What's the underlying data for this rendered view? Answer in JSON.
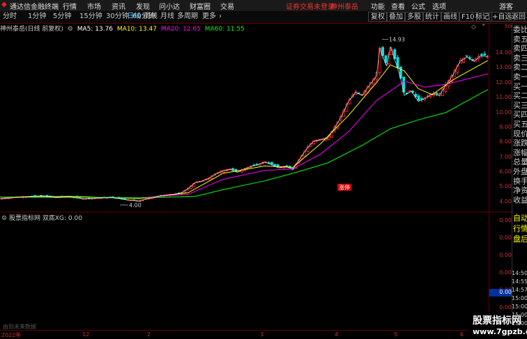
{
  "titlebar": {
    "app_name": "通达信金融终端",
    "menu": [
      "行情",
      "市场",
      "资讯",
      "发现",
      "问小达",
      "财富圈",
      "交易"
    ],
    "notice": "证券交易未登录",
    "stock_name": "神州泰岳",
    "right_menu": [
      "功能",
      "查看",
      "公式",
      "选项",
      "游客"
    ]
  },
  "periods": {
    "items": [
      "分时",
      "1分钟",
      "5分钟",
      "15分钟",
      "30分钟",
      "60分钟",
      "日线",
      "周线",
      "月线",
      "多周期",
      "更多"
    ],
    "active": "日线",
    "more_arrow": "›"
  },
  "toolbar": {
    "buttons": [
      "复权",
      "叠加",
      "多股",
      "统计",
      "画线",
      "F10",
      "标记",
      "+自选",
      "返回"
    ]
  },
  "chart_info": {
    "stock": "神州泰岳(日线 前复权)",
    "ma5_label": "MA5: 13.76",
    "ma10_label": "MA10: 13.47",
    "ma20_label": "MA20: 12.65",
    "ma60_label": "MA60: 11.55",
    "colors": {
      "ma5": "#ffffff",
      "ma10": "#ffff00",
      "ma20": "#ff00ff",
      "ma60": "#00ff00"
    }
  },
  "indicator": {
    "title": "股票指标网",
    "series": "双底XG: 0.00"
  },
  "right_panel": {
    "labels": [
      "委比",
      "卖五",
      "卖四",
      "卖三",
      "卖二",
      "卖一",
      "买一",
      "买二",
      "买三",
      "买四",
      "买五",
      "现价",
      "涨跌",
      "涨幅",
      "总量",
      "外盘",
      "换手",
      "净资",
      "收益"
    ],
    "lower_labels": [
      "自动",
      "行情",
      "盘后"
    ]
  },
  "price_axis": [
    "14.00",
    "13.00",
    "12.00",
    "11.00",
    "10.00",
    "9.00",
    "8.00",
    "7.00",
    "6.00",
    "5.00",
    "4.00"
  ],
  "price_axis_top": "500",
  "indicator_axis": [
    "0.00",
    "0.00",
    "0.00",
    "0.00",
    "0.00",
    "0.00",
    "0.00"
  ],
  "time_axis_labels": [
    "14:50",
    "14:55",
    "14:57",
    "15:00",
    "15:00",
    "15:00",
    "15:00"
  ],
  "indicator_value_box": "0.00",
  "date_axis": [
    "2022年",
    "12",
    "2",
    "3",
    "4",
    "5",
    "6"
  ],
  "annotations": {
    "high": "14.93",
    "low": "4.00",
    "limit_up": "涨停"
  },
  "status_text": "由到未来数据",
  "watermark": {
    "line1": "股票指标网",
    "line2": "www.7gpzb.com"
  },
  "chart_data": {
    "type": "candlestick",
    "title": "神州泰岳(日线 前复权)",
    "ylim": [
      3.7,
      15.6
    ],
    "y_ticks": [
      4,
      5,
      6,
      7,
      8,
      9,
      10,
      11,
      12,
      13,
      14
    ],
    "close_path": [
      [
        0,
        4.2
      ],
      [
        20,
        4.3
      ],
      [
        40,
        4.35
      ],
      [
        60,
        4.4
      ],
      [
        80,
        4.3
      ],
      [
        100,
        4.35
      ],
      [
        120,
        4.2
      ],
      [
        140,
        4.25
      ],
      [
        160,
        4.3
      ],
      [
        180,
        4.15
      ],
      [
        200,
        4.05
      ],
      [
        210,
        4.2
      ],
      [
        230,
        4.4
      ],
      [
        250,
        4.5
      ],
      [
        260,
        4.6
      ],
      [
        270,
        4.9
      ],
      [
        280,
        5.3
      ],
      [
        290,
        5.4
      ],
      [
        300,
        5.6
      ],
      [
        310,
        5.9
      ],
      [
        320,
        6.1
      ],
      [
        330,
        6.2
      ],
      [
        340,
        6.0
      ],
      [
        350,
        6.2
      ],
      [
        360,
        6.4
      ],
      [
        370,
        6.5
      ],
      [
        380,
        6.7
      ],
      [
        390,
        6.5
      ],
      [
        400,
        6.3
      ],
      [
        410,
        6.4
      ],
      [
        420,
        6.2
      ],
      [
        430,
        6.9
      ],
      [
        440,
        7.6
      ],
      [
        450,
        8.1
      ],
      [
        460,
        8.2
      ],
      [
        470,
        8.3
      ],
      [
        480,
        9.0
      ],
      [
        490,
        9.8
      ],
      [
        500,
        10.8
      ],
      [
        510,
        11.4
      ],
      [
        520,
        11.2
      ],
      [
        530,
        11.9
      ],
      [
        540,
        12.5
      ],
      [
        545,
        14.4
      ],
      [
        550,
        13.7
      ],
      [
        555,
        13.2
      ],
      [
        560,
        14.5
      ],
      [
        565,
        13.8
      ],
      [
        570,
        13.1
      ],
      [
        575,
        12.3
      ],
      [
        580,
        11.2
      ],
      [
        590,
        11.5
      ],
      [
        600,
        10.8
      ],
      [
        610,
        11.0
      ],
      [
        620,
        11.3
      ],
      [
        630,
        11.2
      ],
      [
        640,
        11.9
      ],
      [
        650,
        12.6
      ],
      [
        660,
        13.5
      ],
      [
        670,
        13.8
      ],
      [
        680,
        13.5
      ],
      [
        690,
        13.9
      ],
      [
        700,
        13.8
      ]
    ],
    "ma_series": [
      {
        "name": "MA10",
        "points": [
          [
            0,
            4.3
          ],
          [
            100,
            4.35
          ],
          [
            200,
            4.2
          ],
          [
            270,
            4.6
          ],
          [
            320,
            5.9
          ],
          [
            380,
            6.4
          ],
          [
            420,
            6.3
          ],
          [
            460,
            7.9
          ],
          [
            500,
            9.8
          ],
          [
            540,
            12.0
          ],
          [
            560,
            13.2
          ],
          [
            580,
            12.8
          ],
          [
            600,
            11.6
          ],
          [
            620,
            11.2
          ],
          [
            650,
            12.2
          ],
          [
            700,
            13.5
          ]
        ]
      },
      {
        "name": "MA20",
        "points": [
          [
            0,
            4.3
          ],
          [
            100,
            4.3
          ],
          [
            200,
            4.25
          ],
          [
            270,
            4.5
          ],
          [
            320,
            5.5
          ],
          [
            380,
            6.1
          ],
          [
            420,
            6.2
          ],
          [
            460,
            7.2
          ],
          [
            500,
            8.7
          ],
          [
            540,
            10.8
          ],
          [
            580,
            12.1
          ],
          [
            610,
            11.7
          ],
          [
            640,
            11.9
          ],
          [
            700,
            12.6
          ]
        ]
      },
      {
        "name": "MA60",
        "points": [
          [
            0,
            4.3
          ],
          [
            100,
            4.3
          ],
          [
            200,
            4.25
          ],
          [
            280,
            4.35
          ],
          [
            320,
            4.8
          ],
          [
            380,
            5.4
          ],
          [
            420,
            5.9
          ],
          [
            470,
            6.6
          ],
          [
            520,
            7.8
          ],
          [
            560,
            8.9
          ],
          [
            600,
            9.5
          ],
          [
            640,
            10.0
          ],
          [
            700,
            11.55
          ]
        ]
      }
    ]
  }
}
